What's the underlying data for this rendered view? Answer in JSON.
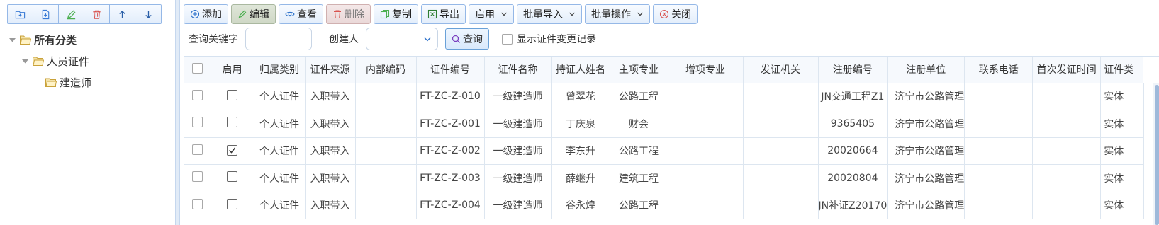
{
  "colors": {
    "accent": "#95b8e7",
    "folder": "#d9b65a",
    "delete": "#d9534f",
    "edit": "#4caf50"
  },
  "left_toolbar": [
    {
      "icon": "folder-add-icon"
    },
    {
      "icon": "file-add-icon"
    },
    {
      "icon": "pencil-icon"
    },
    {
      "icon": "trash-icon"
    },
    {
      "icon": "arrow-up-icon"
    },
    {
      "icon": "arrow-down-icon"
    }
  ],
  "tree": {
    "root": "所有分类",
    "child": "人员证件",
    "leaf": "建造师"
  },
  "toolbar": {
    "add": "添加",
    "edit": "编辑",
    "view": "查看",
    "delete": "删除",
    "copy": "复制",
    "export": "导出",
    "enable": "启用",
    "batch_import": "批量导入",
    "batch_ops": "批量操作",
    "close": "关闭"
  },
  "search": {
    "keyword_label": "查询关键字",
    "keyword_value": "",
    "creator_label": "创建人",
    "creator_value": "",
    "query_label": "查询",
    "show_changes_label": "显示证件变更记录",
    "show_changes_checked": false
  },
  "grid": {
    "columns": [
      "启用",
      "归属类别",
      "证件来源",
      "内部编码",
      "证件编号",
      "证件名称",
      "持证人姓名",
      "主项专业",
      "增项专业",
      "发证机关",
      "注册编号",
      "注册单位",
      "联系电话",
      "首次发证时间",
      "证件类"
    ],
    "rows": [
      {
        "checked": false,
        "enabled": false,
        "cells": [
          "个人证件",
          "入职带入",
          "",
          "FT-ZC-Z-010",
          "一级建造师",
          "曾翠花",
          "公路工程",
          "",
          "",
          "JN交通工程Z1",
          "济宁市公路管理",
          "",
          "",
          "实体"
        ]
      },
      {
        "checked": false,
        "enabled": false,
        "cells": [
          "个人证件",
          "入职带入",
          "",
          "FT-ZC-Z-001",
          "一级建造师",
          "丁庆泉",
          "财会",
          "",
          "",
          "9365405",
          "济宁市公路管理",
          "",
          "",
          "实体"
        ]
      },
      {
        "checked": false,
        "enabled": true,
        "cells": [
          "个人证件",
          "入职带入",
          "",
          "FT-ZC-Z-002",
          "一级建造师",
          "李东升",
          "公路工程",
          "",
          "",
          "20020664",
          "济宁市公路管理",
          "",
          "",
          "实体"
        ]
      },
      {
        "checked": false,
        "enabled": false,
        "cells": [
          "个人证件",
          "入职带入",
          "",
          "FT-ZC-Z-003",
          "一级建造师",
          "薛继升",
          "建筑工程",
          "",
          "",
          "20020804",
          "济宁市公路管理",
          "",
          "",
          "实体"
        ]
      },
      {
        "checked": false,
        "enabled": false,
        "cells": [
          "个人证件",
          "入职带入",
          "",
          "FT-ZC-Z-004",
          "一级建造师",
          "谷永煌",
          "公路工程",
          "",
          "",
          "JN补证Z20170",
          "济宁市公路管理",
          "",
          "",
          "实体"
        ]
      }
    ]
  }
}
